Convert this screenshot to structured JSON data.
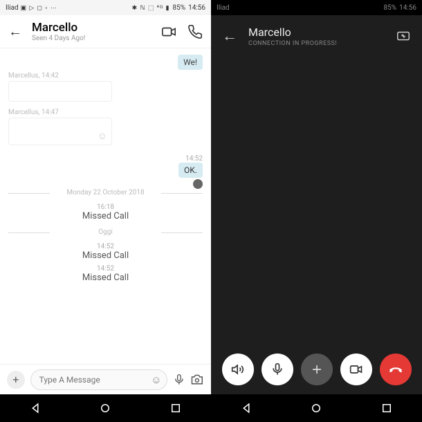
{
  "left": {
    "status": {
      "carrier": "Iliad",
      "battery": "85%",
      "time": "14:56"
    },
    "header": {
      "title": "Marcello",
      "subtitle": "Seen 4 Days Ago!"
    },
    "chat": {
      "msg1": "We!",
      "meta1": "Marcellus, 14:42",
      "meta2": "Marcellus, 14:47",
      "time_ok": "14:52",
      "msg_ok": "OK.",
      "date_divider": "Monday 22 October 2018",
      "call1_time": "16:18",
      "call1_label": "Missed Call",
      "divider2": "Oggi",
      "call2_time": "14:52",
      "call2_label": "Missed Call",
      "call3_time": "14:52",
      "call3_label": "Missed Call"
    },
    "input": {
      "placeholder": "Type A Message"
    }
  },
  "right": {
    "status": {
      "carrier": "Iliad",
      "battery": "85%",
      "time": "14:56"
    },
    "header": {
      "title": "Marcello",
      "status": "CONNECTION IN PROGRESS!"
    }
  }
}
